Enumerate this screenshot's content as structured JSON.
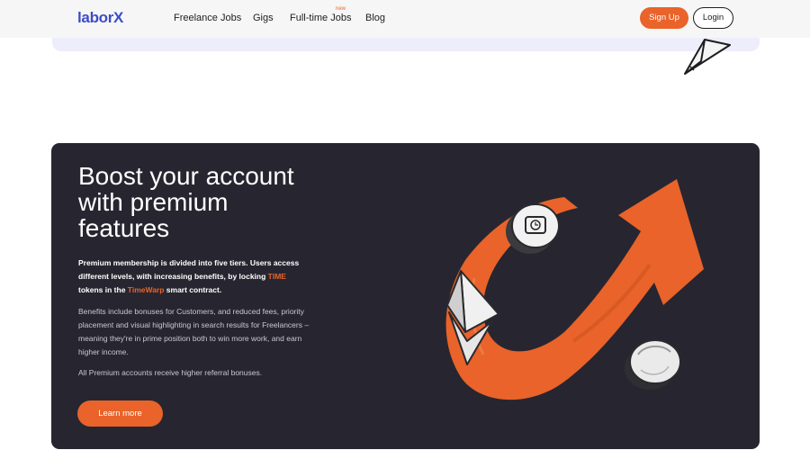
{
  "header": {
    "logo": "laborX",
    "nav": [
      "Freelance Jobs",
      "Gigs",
      "Full-time Jobs",
      "Blog"
    ],
    "new_badge": "new",
    "signup_label": "Sign Up",
    "login_label": "Login"
  },
  "premium": {
    "title_lines": [
      "Boost your account",
      "with premium",
      "features"
    ],
    "intro_part1": "Premium membership is divided into five tiers. Users access different levels, with increasing benefits, by locking ",
    "token_name": "TIME",
    "intro_part2": " tokens in the ",
    "contract_name": "TimeWarp",
    "intro_part3": " smart contract.",
    "benefits": "Benefits include bonuses for Customers, and reduced fees, priority placement and visual highlighting in search results for Freelancers – meaning they're in prime position both to win more work, and earn higher income.",
    "referral": "All Premium accounts receive higher referral bonuses.",
    "cta_label": "Learn more"
  },
  "colors": {
    "brand": "#3d4cc7",
    "accent": "#e9632a",
    "card_bg": "#272630"
  },
  "icons": [
    "paper-plane-icon",
    "arrow-illustration",
    "clock-coin-icon",
    "ethereum-icon",
    "silver-coin-icon"
  ]
}
